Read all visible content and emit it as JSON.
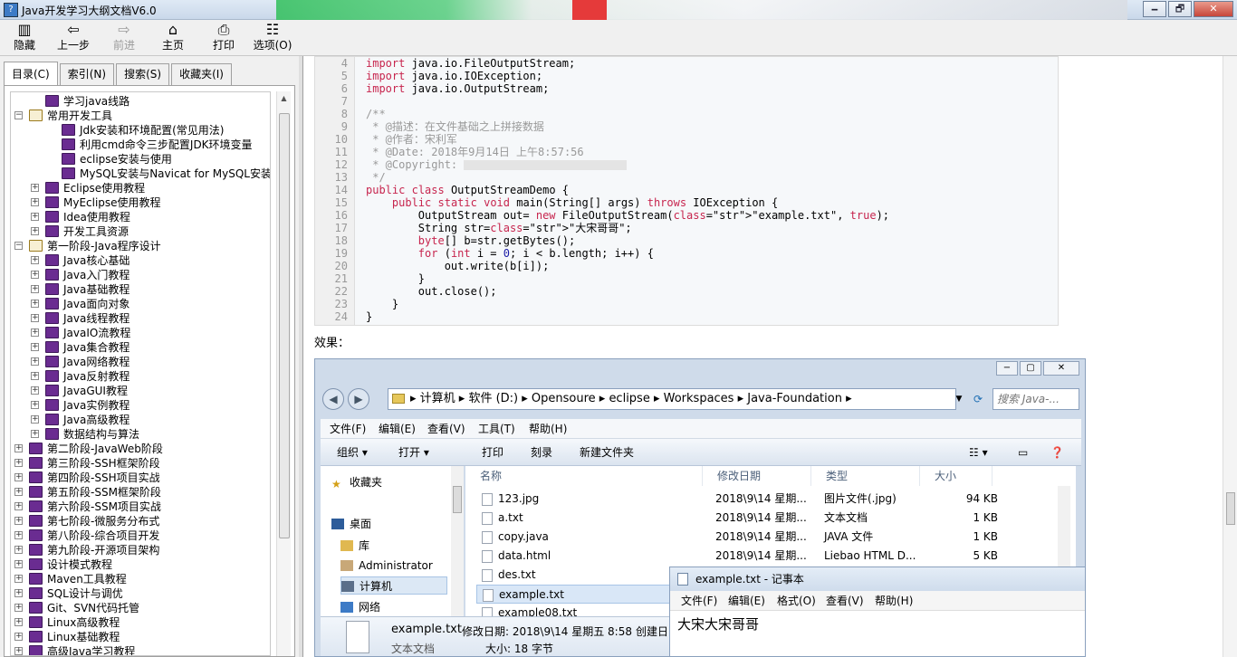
{
  "window": {
    "title": "Java开发学习大纲文档V6.0",
    "minimize": "🗕",
    "maximize": "🗗",
    "close": "✕"
  },
  "toolbar": {
    "hide": "隐藏",
    "back": "上一步",
    "forward": "前进",
    "home": "主页",
    "print": "打印",
    "options": "选项(O)"
  },
  "tabs": [
    "目录(C)",
    "索引(N)",
    "搜索(S)",
    "收藏夹(I)"
  ],
  "tree": [
    {
      "label": "学习java线路",
      "level": 1,
      "exp": "",
      "open": false
    },
    {
      "label": "常用开发工具",
      "level": 0,
      "exp": "−",
      "open": true
    },
    {
      "label": "Jdk安装和环境配置(常见用法)",
      "level": 2,
      "exp": "",
      "open": false
    },
    {
      "label": "利用cmd命令三步配置JDK环境变量",
      "level": 2,
      "exp": "",
      "open": false
    },
    {
      "label": "eclipse安装与使用",
      "level": 2,
      "exp": "",
      "open": false
    },
    {
      "label": "MySQL安装与Navicat for MySQL安装破解",
      "level": 2,
      "exp": "",
      "open": false
    },
    {
      "label": "Eclipse使用教程",
      "level": 1,
      "exp": "+",
      "open": false
    },
    {
      "label": "MyEclipse使用教程",
      "level": 1,
      "exp": "+",
      "open": false
    },
    {
      "label": "Idea使用教程",
      "level": 1,
      "exp": "+",
      "open": false
    },
    {
      "label": "开发工具资源",
      "level": 1,
      "exp": "+",
      "open": false
    },
    {
      "label": "第一阶段-Java程序设计",
      "level": 0,
      "exp": "−",
      "open": true
    },
    {
      "label": "Java核心基础",
      "level": 1,
      "exp": "+",
      "open": false
    },
    {
      "label": "Java入门教程",
      "level": 1,
      "exp": "+",
      "open": false
    },
    {
      "label": "Java基础教程",
      "level": 1,
      "exp": "+",
      "open": false
    },
    {
      "label": "Java面向对象",
      "level": 1,
      "exp": "+",
      "open": false
    },
    {
      "label": "Java线程教程",
      "level": 1,
      "exp": "+",
      "open": false
    },
    {
      "label": "JavaIO流教程",
      "level": 1,
      "exp": "+",
      "open": false
    },
    {
      "label": "Java集合教程",
      "level": 1,
      "exp": "+",
      "open": false
    },
    {
      "label": "Java网络教程",
      "level": 1,
      "exp": "+",
      "open": false
    },
    {
      "label": "Java反射教程",
      "level": 1,
      "exp": "+",
      "open": false
    },
    {
      "label": "JavaGUI教程",
      "level": 1,
      "exp": "+",
      "open": false
    },
    {
      "label": "Java实例教程",
      "level": 1,
      "exp": "+",
      "open": false
    },
    {
      "label": "Java高级教程",
      "level": 1,
      "exp": "+",
      "open": false
    },
    {
      "label": "数据结构与算法",
      "level": 1,
      "exp": "+",
      "open": false
    },
    {
      "label": "第二阶段-JavaWeb阶段",
      "level": 0,
      "exp": "+",
      "open": false
    },
    {
      "label": "第三阶段-SSH框架阶段",
      "level": 0,
      "exp": "+",
      "open": false
    },
    {
      "label": "第四阶段-SSH项目实战",
      "level": 0,
      "exp": "+",
      "open": false
    },
    {
      "label": "第五阶段-SSM框架阶段",
      "level": 0,
      "exp": "+",
      "open": false
    },
    {
      "label": "第六阶段-SSM项目实战",
      "level": 0,
      "exp": "+",
      "open": false
    },
    {
      "label": "第七阶段-微服务分布式",
      "level": 0,
      "exp": "+",
      "open": false
    },
    {
      "label": "第八阶段-综合项目开发",
      "level": 0,
      "exp": "+",
      "open": false
    },
    {
      "label": "第九阶段-开源项目架构",
      "level": 0,
      "exp": "+",
      "open": false
    },
    {
      "label": "设计模式教程",
      "level": 0,
      "exp": "+",
      "open": false
    },
    {
      "label": "Maven工具教程",
      "level": 0,
      "exp": "+",
      "open": false
    },
    {
      "label": "SQL设计与调优",
      "level": 0,
      "exp": "+",
      "open": false
    },
    {
      "label": "Git、SVN代码托管",
      "level": 0,
      "exp": "+",
      "open": false
    },
    {
      "label": "Linux高级教程",
      "level": 0,
      "exp": "+",
      "open": false
    },
    {
      "label": "Linux基础教程",
      "level": 0,
      "exp": "+",
      "open": false
    },
    {
      "label": "高级Java学习教程",
      "level": 0,
      "exp": "+",
      "open": false
    }
  ],
  "code": [
    {
      "n": "4",
      "t": "import java.io.FileOutputStream;",
      "k": "imp"
    },
    {
      "n": "5",
      "t": "import java.io.IOException;",
      "k": "imp"
    },
    {
      "n": "6",
      "t": "import java.io.OutputStream;",
      "k": "imp"
    },
    {
      "n": "7",
      "t": "",
      "k": ""
    },
    {
      "n": "8",
      "t": "/**",
      "k": "cm"
    },
    {
      "n": "9",
      "t": " * @描述：在文件基础之上拼接数据",
      "k": "cm"
    },
    {
      "n": "10",
      "t": " * @作者：宋利军",
      "k": "cm"
    },
    {
      "n": "11",
      "t": " * @Date: 2018年9月14日 上午8:57:56",
      "k": "cm"
    },
    {
      "n": "12",
      "t": " * @Copyright: ",
      "k": "cmblur"
    },
    {
      "n": "13",
      "t": " */",
      "k": "cm"
    },
    {
      "n": "14",
      "t": "public class OutputStreamDemo {",
      "k": "cls"
    },
    {
      "n": "15",
      "t": "    public static void main(String[] args) throws IOException {",
      "k": "main"
    },
    {
      "n": "16",
      "t": "        OutputStream out= new FileOutputStream(\"example.txt\", true);",
      "k": "new"
    },
    {
      "n": "17",
      "t": "        String str=\"大宋哥哥\";",
      "k": "str"
    },
    {
      "n": "18",
      "t": "        byte[] b=str.getBytes();",
      "k": "byte"
    },
    {
      "n": "19",
      "t": "        for (int i = 0; i < b.length; i++) {",
      "k": "for"
    },
    {
      "n": "20",
      "t": "            out.write(b[i]);",
      "k": ""
    },
    {
      "n": "21",
      "t": "        }",
      "k": ""
    },
    {
      "n": "22",
      "t": "        out.close();",
      "k": ""
    },
    {
      "n": "23",
      "t": "    }",
      "k": ""
    },
    {
      "n": "24",
      "t": "}",
      "k": ""
    }
  ],
  "effect_label": "效果：",
  "explorer": {
    "path": [
      "计算机",
      "软件 (D:)",
      "Opensoure",
      "eclipse",
      "Workspaces",
      "Java-Foundation"
    ],
    "search_placeholder": "搜索 Java-...",
    "menu": [
      "文件(F)",
      "编辑(E)",
      "查看(V)",
      "工具(T)",
      "帮助(H)"
    ],
    "commands": [
      "组织 ▾",
      "打开 ▾",
      "打印",
      "刻录",
      "新建文件夹"
    ],
    "nav": [
      "收藏夹",
      "桌面",
      "库",
      "Administrator",
      "计算机",
      "网络"
    ],
    "columns": [
      "名称",
      "修改日期",
      "类型",
      "大小"
    ],
    "files": [
      {
        "name": "123.jpg",
        "date": "2018\\9\\14 星期...",
        "type": "图片文件(.jpg)",
        "size": "94 KB"
      },
      {
        "name": "a.txt",
        "date": "2018\\9\\14 星期...",
        "type": "文本文档",
        "size": "1 KB"
      },
      {
        "name": "copy.java",
        "date": "2018\\9\\14 星期...",
        "type": "JAVA 文件",
        "size": "1 KB"
      },
      {
        "name": "data.html",
        "date": "2018\\9\\14 星期...",
        "type": "Liebao HTML D...",
        "size": "5 KB"
      },
      {
        "name": "des.txt",
        "date": "",
        "type": "",
        "size": ""
      },
      {
        "name": "example.txt",
        "date": "",
        "type": "",
        "size": ""
      },
      {
        "name": "example08.txt",
        "date": "",
        "type": "",
        "size": ""
      }
    ],
    "details": {
      "name": "example.txt",
      "modified": "修改日期: 2018\\9\\14 星期五 8:58",
      "created": "创建日",
      "type": "文本文档",
      "size": "大小: 18 字节"
    }
  },
  "notepad": {
    "title": "example.txt - 记事本",
    "menu": [
      "文件(F)",
      "编辑(E)",
      "格式(O)",
      "查看(V)",
      "帮助(H)"
    ],
    "text": "大宋大宋哥哥"
  }
}
